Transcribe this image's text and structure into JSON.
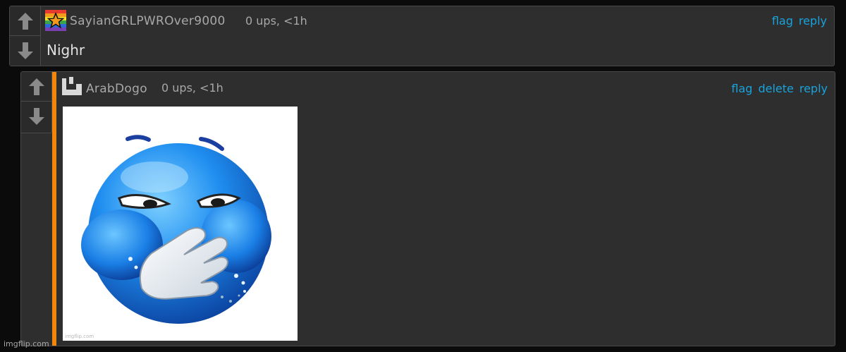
{
  "comments": [
    {
      "username": "SayianGRLPWROver9000",
      "meta": "0 ups, <1h",
      "actions": [
        "flag",
        "reply"
      ],
      "text": "Nighr",
      "avatar_icon": "rainbow-star-avatar-icon"
    },
    {
      "username": "ArabDogo",
      "meta": "0 ups, <1h",
      "actions": [
        "flag",
        "delete",
        "reply"
      ],
      "image_caption": "imgflip.com",
      "image_icon": "blue-emoji-laughing-icon",
      "avatar_icon": "pixel-dog-avatar-icon",
      "thread_indicator_color": "#f0860c"
    }
  ],
  "colors": {
    "background": "#0b0b0b",
    "panel": "#2e2e2e",
    "link": "#18a3dc",
    "muted_text": "#a8a8a8"
  },
  "watermark": "imgflip.com"
}
